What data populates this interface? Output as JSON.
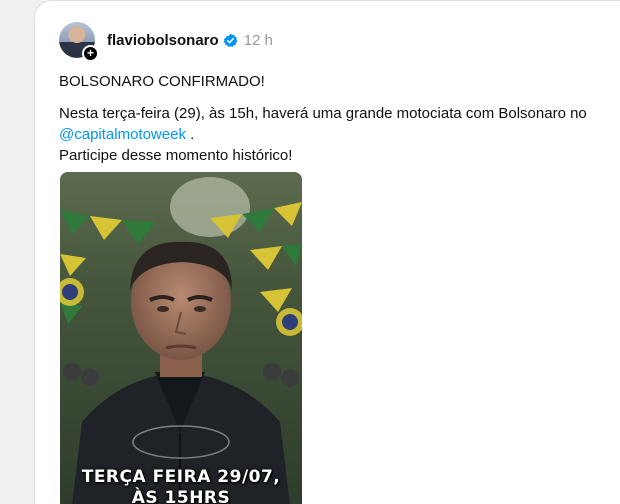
{
  "post": {
    "username": "flaviobolsonaro",
    "timestamp": "12 h",
    "headline": "BOLSONARO CONFIRMADO!",
    "body_line1": "Nesta terça-feira (29), às 15h, haverá uma grande motociata com Bolsonaro no",
    "mention": "@capitalmotoweek",
    "mention_suffix": " .",
    "body_line3": "Participe desse momento histórico!"
  },
  "media": {
    "caption_line1": "TERÇA FEIRA 29/07,",
    "caption_line2": "ÀS 15HRS"
  },
  "icons": {
    "avatar_badge": "plus-icon",
    "verified": "verified-badge-icon"
  },
  "colors": {
    "mention": "#0095f6",
    "verified": "#0095f6",
    "timestamp": "#999999",
    "flag_green": "#2f7a3a",
    "flag_yellow": "#d6c436"
  }
}
